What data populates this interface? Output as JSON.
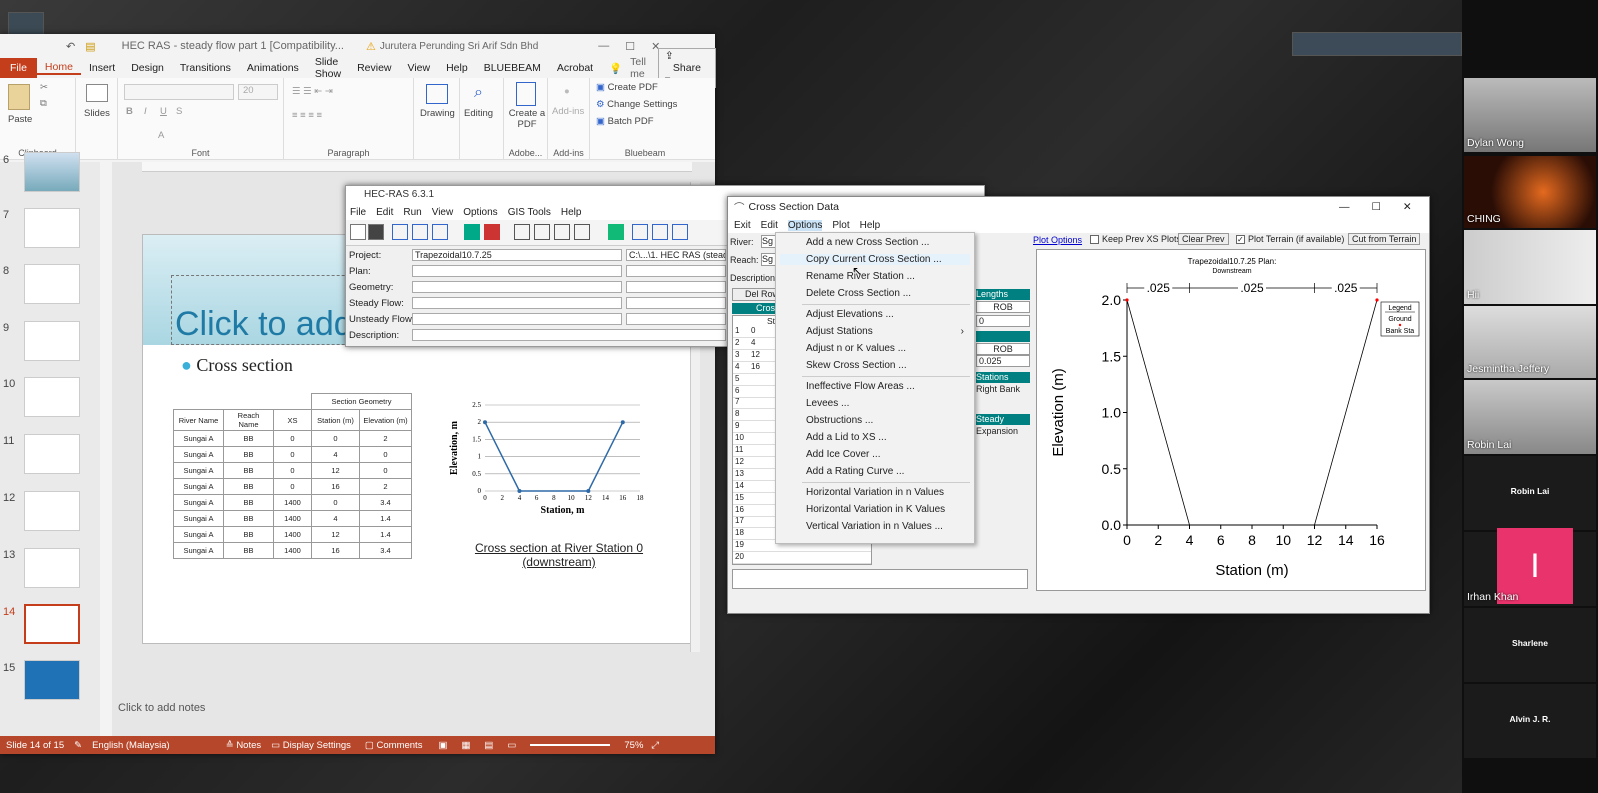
{
  "ppt": {
    "title": "HEC RAS - steady flow part 1 [Compatibility...",
    "account": "Jurutera Perunding Sri Arif Sdn Bhd",
    "menu": [
      "File",
      "Home",
      "Insert",
      "Design",
      "Transitions",
      "Animations",
      "Slide Show",
      "Review",
      "View",
      "Help",
      "BLUEBEAM",
      "Acrobat"
    ],
    "tellme": "Tell me",
    "share": "Share",
    "ribbon": {
      "paste": "Paste",
      "slides": "Slides",
      "drawing": "Drawing",
      "editing": "Editing",
      "create_pdf_btn": "Create a PDF",
      "addins_btn": "Add-ins",
      "create_pdf": "Create PDF",
      "change_settings": "Change Settings",
      "batch_pdf": "Batch PDF",
      "groups": [
        "Clipboard",
        "Font",
        "Paragraph",
        "Adobe...",
        "Add-ins",
        "Bluebeam"
      ],
      "font_size": "20"
    },
    "thumb_numbers": [
      "6",
      "7",
      "8",
      "9",
      "10",
      "11",
      "12",
      "13",
      "14",
      "15"
    ],
    "slide": {
      "title": "Click to add",
      "bullet": "Cross section",
      "table_header_group": "Section Geometry",
      "table_cols": [
        "River Name",
        "Reach Name",
        "XS",
        "Station (m)",
        "Elevation (m)"
      ],
      "table_rows": [
        [
          "Sungai A",
          "BB",
          "0",
          "0",
          "2"
        ],
        [
          "Sungai A",
          "BB",
          "0",
          "4",
          "0"
        ],
        [
          "Sungai A",
          "BB",
          "0",
          "12",
          "0"
        ],
        [
          "Sungai A",
          "BB",
          "0",
          "16",
          "2"
        ],
        [
          "Sungai A",
          "BB",
          "1400",
          "0",
          "3.4"
        ],
        [
          "Sungai A",
          "BB",
          "1400",
          "4",
          "1.4"
        ],
        [
          "Sungai A",
          "BB",
          "1400",
          "12",
          "1.4"
        ],
        [
          "Sungai A",
          "BB",
          "1400",
          "16",
          "3.4"
        ]
      ],
      "chart_caption": "Cross section at River Station 0 (downstream)"
    },
    "notes": "Click to add notes",
    "status": {
      "slide": "Slide 14 of 15",
      "lang": "English (Malaysia)",
      "notes": "Notes",
      "display": "Display Settings",
      "comments": "Comments",
      "zoom": "75%"
    }
  },
  "hec": {
    "title": "HEC-RAS 6.3.1",
    "menu": [
      "File",
      "Edit",
      "Run",
      "View",
      "Options",
      "GIS Tools",
      "Help"
    ],
    "labels": [
      "Project:",
      "Plan:",
      "Geometry:",
      "Steady Flow:",
      "Unsteady Flow:",
      "Description:"
    ],
    "project": "Trapezoidal10.7.25",
    "path": "C:\\...\\1. HEC RAS (steady"
  },
  "xs": {
    "title": "Cross Section Data",
    "menu": [
      "Exit",
      "Edit",
      "Options",
      "Plot",
      "Help"
    ],
    "river_label": "River:",
    "river_val": "Sg T",
    "reach_label": "Reach:",
    "reach_val": "Sg T",
    "description": "Description",
    "del_row": "Del Row",
    "cross": "Cross",
    "sta": "Sta",
    "row_vals": [
      "0",
      "4",
      "12",
      "16"
    ],
    "row_nums": [
      "1",
      "2",
      "3",
      "4",
      "5",
      "6",
      "7",
      "8",
      "9",
      "10",
      "11",
      "12",
      "13",
      "14",
      "15",
      "16",
      "17",
      "18",
      "19",
      "20"
    ],
    "right_labels": {
      "lengths": "Lengths",
      "rob": "ROB",
      "rob_val": "0",
      "rob2": "ROB",
      "n_val": "0.025",
      "stations": "Stations",
      "right_bank": "Right Bank",
      "steady": "Steady",
      "expansion": "Expansion"
    },
    "plot_options": "Plot Options",
    "keep_prev": "Keep Prev XS Plots",
    "clear_prev": "Clear Prev",
    "plot_terrain": "Plot Terrain (if available)",
    "cut_terrain": "Cut from Terrain",
    "plot_title": "Trapezoidal10.7.25     Plan:",
    "plot_subtitle": "Downstream",
    "legend": {
      "title": "Legend",
      "ground": "Ground",
      "bank": "Bank Sta"
    },
    "n_labels": [
      ".025",
      ".025",
      ".025"
    ],
    "menu_items": [
      "Add a new Cross Section ...",
      "Copy Current Cross Section ...",
      "Rename River Station ...",
      "Delete Cross Section ...",
      "Adjust Elevations ...",
      "Adjust Stations",
      "Adjust n or K values ...",
      "Skew Cross Section ...",
      "Ineffective Flow Areas ...",
      "Levees ...",
      "Obstructions ...",
      "Add a Lid to XS ...",
      "Add Ice Cover ...",
      "Add a Rating Curve ...",
      "Horizontal Variation in n Values",
      "Horizontal Variation in K Values",
      "Vertical Variation in n Values ..."
    ]
  },
  "participants": [
    "Dylan Wong",
    "CHING",
    "Hii",
    "Jesmintha Jeffery",
    "Robin Lai",
    "Robin Lai",
    "Irhan Khan",
    "Sharlene",
    "Alvin J. R."
  ],
  "irhan_initial": "I",
  "chart_data": [
    {
      "type": "line",
      "x": [
        0,
        4,
        12,
        16
      ],
      "y": [
        2,
        0,
        0,
        2
      ],
      "xlabel": "Station, m",
      "ylabel": "Elevation, m",
      "xlim": [
        0,
        18
      ],
      "ylim": [
        0,
        2.5
      ],
      "xticks": [
        0,
        2,
        4,
        6,
        8,
        10,
        12,
        14,
        16,
        18
      ],
      "yticks": [
        0,
        0.5,
        1,
        1.5,
        2,
        2.5
      ],
      "grid": true
    },
    {
      "type": "line",
      "title": "Trapezoidal10.7.25     Plan:",
      "subtitle": "Downstream",
      "x": [
        0,
        4,
        12,
        16
      ],
      "y": [
        2,
        0,
        0,
        2
      ],
      "xlabel": "Station (m)",
      "ylabel": "Elevation (m)",
      "xlim": [
        0,
        16
      ],
      "ylim": [
        0,
        2
      ],
      "xticks": [
        0,
        2,
        4,
        6,
        8,
        10,
        12,
        14,
        16
      ],
      "yticks": [
        0,
        0.5,
        1,
        1.5,
        2
      ],
      "legend": [
        "Ground",
        "Bank Sta"
      ],
      "legend_position": "top-right",
      "colors": {
        "ground": "#000000",
        "bank": "#ff0000"
      }
    }
  ]
}
